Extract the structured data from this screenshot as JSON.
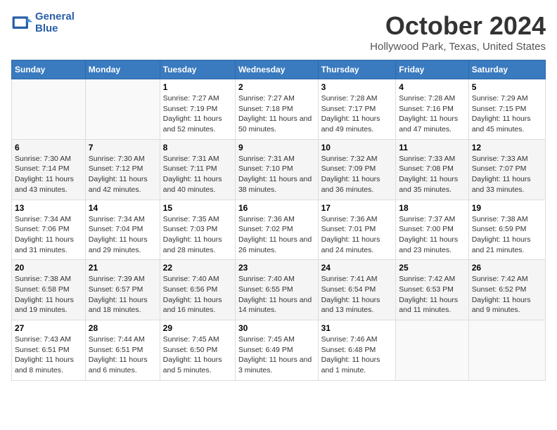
{
  "header": {
    "logo_line1": "General",
    "logo_line2": "Blue",
    "month": "October 2024",
    "location": "Hollywood Park, Texas, United States"
  },
  "days_of_week": [
    "Sunday",
    "Monday",
    "Tuesday",
    "Wednesday",
    "Thursday",
    "Friday",
    "Saturday"
  ],
  "weeks": [
    [
      null,
      null,
      {
        "day": 1,
        "sunrise": "7:27 AM",
        "sunset": "7:19 PM",
        "daylight": "11 hours and 52 minutes."
      },
      {
        "day": 2,
        "sunrise": "7:27 AM",
        "sunset": "7:18 PM",
        "daylight": "11 hours and 50 minutes."
      },
      {
        "day": 3,
        "sunrise": "7:28 AM",
        "sunset": "7:17 PM",
        "daylight": "11 hours and 49 minutes."
      },
      {
        "day": 4,
        "sunrise": "7:28 AM",
        "sunset": "7:16 PM",
        "daylight": "11 hours and 47 minutes."
      },
      {
        "day": 5,
        "sunrise": "7:29 AM",
        "sunset": "7:15 PM",
        "daylight": "11 hours and 45 minutes."
      }
    ],
    [
      {
        "day": 6,
        "sunrise": "7:30 AM",
        "sunset": "7:14 PM",
        "daylight": "11 hours and 43 minutes."
      },
      {
        "day": 7,
        "sunrise": "7:30 AM",
        "sunset": "7:12 PM",
        "daylight": "11 hours and 42 minutes."
      },
      {
        "day": 8,
        "sunrise": "7:31 AM",
        "sunset": "7:11 PM",
        "daylight": "11 hours and 40 minutes."
      },
      {
        "day": 9,
        "sunrise": "7:31 AM",
        "sunset": "7:10 PM",
        "daylight": "11 hours and 38 minutes."
      },
      {
        "day": 10,
        "sunrise": "7:32 AM",
        "sunset": "7:09 PM",
        "daylight": "11 hours and 36 minutes."
      },
      {
        "day": 11,
        "sunrise": "7:33 AM",
        "sunset": "7:08 PM",
        "daylight": "11 hours and 35 minutes."
      },
      {
        "day": 12,
        "sunrise": "7:33 AM",
        "sunset": "7:07 PM",
        "daylight": "11 hours and 33 minutes."
      }
    ],
    [
      {
        "day": 13,
        "sunrise": "7:34 AM",
        "sunset": "7:06 PM",
        "daylight": "11 hours and 31 minutes."
      },
      {
        "day": 14,
        "sunrise": "7:34 AM",
        "sunset": "7:04 PM",
        "daylight": "11 hours and 29 minutes."
      },
      {
        "day": 15,
        "sunrise": "7:35 AM",
        "sunset": "7:03 PM",
        "daylight": "11 hours and 28 minutes."
      },
      {
        "day": 16,
        "sunrise": "7:36 AM",
        "sunset": "7:02 PM",
        "daylight": "11 hours and 26 minutes."
      },
      {
        "day": 17,
        "sunrise": "7:36 AM",
        "sunset": "7:01 PM",
        "daylight": "11 hours and 24 minutes."
      },
      {
        "day": 18,
        "sunrise": "7:37 AM",
        "sunset": "7:00 PM",
        "daylight": "11 hours and 23 minutes."
      },
      {
        "day": 19,
        "sunrise": "7:38 AM",
        "sunset": "6:59 PM",
        "daylight": "11 hours and 21 minutes."
      }
    ],
    [
      {
        "day": 20,
        "sunrise": "7:38 AM",
        "sunset": "6:58 PM",
        "daylight": "11 hours and 19 minutes."
      },
      {
        "day": 21,
        "sunrise": "7:39 AM",
        "sunset": "6:57 PM",
        "daylight": "11 hours and 18 minutes."
      },
      {
        "day": 22,
        "sunrise": "7:40 AM",
        "sunset": "6:56 PM",
        "daylight": "11 hours and 16 minutes."
      },
      {
        "day": 23,
        "sunrise": "7:40 AM",
        "sunset": "6:55 PM",
        "daylight": "11 hours and 14 minutes."
      },
      {
        "day": 24,
        "sunrise": "7:41 AM",
        "sunset": "6:54 PM",
        "daylight": "11 hours and 13 minutes."
      },
      {
        "day": 25,
        "sunrise": "7:42 AM",
        "sunset": "6:53 PM",
        "daylight": "11 hours and 11 minutes."
      },
      {
        "day": 26,
        "sunrise": "7:42 AM",
        "sunset": "6:52 PM",
        "daylight": "11 hours and 9 minutes."
      }
    ],
    [
      {
        "day": 27,
        "sunrise": "7:43 AM",
        "sunset": "6:51 PM",
        "daylight": "11 hours and 8 minutes."
      },
      {
        "day": 28,
        "sunrise": "7:44 AM",
        "sunset": "6:51 PM",
        "daylight": "11 hours and 6 minutes."
      },
      {
        "day": 29,
        "sunrise": "7:45 AM",
        "sunset": "6:50 PM",
        "daylight": "11 hours and 5 minutes."
      },
      {
        "day": 30,
        "sunrise": "7:45 AM",
        "sunset": "6:49 PM",
        "daylight": "11 hours and 3 minutes."
      },
      {
        "day": 31,
        "sunrise": "7:46 AM",
        "sunset": "6:48 PM",
        "daylight": "11 hours and 1 minute."
      },
      null,
      null
    ]
  ],
  "labels": {
    "sunrise": "Sunrise:",
    "sunset": "Sunset:",
    "daylight": "Daylight:"
  }
}
